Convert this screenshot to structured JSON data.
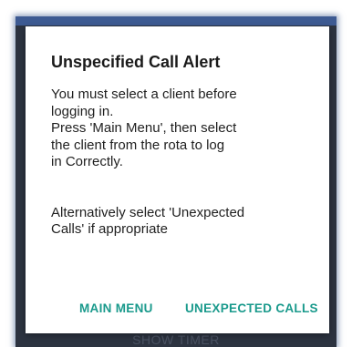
{
  "background_screen": {
    "button_label": "SHOW TIMER"
  },
  "dialog": {
    "title": "Unspecified Call Alert",
    "message": "You must select a client before\nlogging in.\n Press 'Main Menu', then select\nthe client from the rota to log\nin Correctly.\n\n\nAlternatively select 'Unexpected\nCalls' if appropriate",
    "actions": {
      "main_menu": "MAIN MENU",
      "unexpected_calls": "UNEXPECTED CALLS"
    }
  },
  "colors": {
    "accent": "#1a9a8c",
    "app_background": "#2c3340",
    "app_header": "#3d5a92"
  }
}
